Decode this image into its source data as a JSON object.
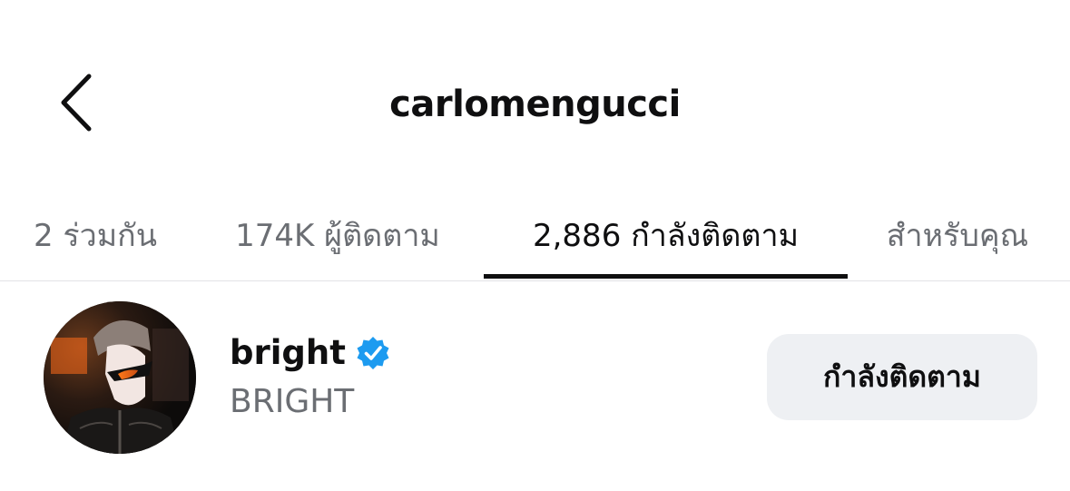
{
  "header": {
    "back_icon": "chevron-left-icon",
    "title": "carlomengucci"
  },
  "tabs": [
    {
      "label": "2 ร่วมกัน",
      "active": false
    },
    {
      "label": "174K ผู้ติดตาม",
      "active": false
    },
    {
      "label": "2,886 กำลังติดตาม",
      "active": true
    },
    {
      "label": "สำหรับคุณ",
      "active": false
    }
  ],
  "list": [
    {
      "username": "bright",
      "verified_icon": "verified-badge-icon",
      "full_name": "BRIGHT",
      "button_label": "กำลังติดตาม",
      "avatar_icon": "profile-photo"
    }
  ],
  "colors": {
    "text_primary": "#0f0f10",
    "text_secondary": "#6b6e73",
    "verified": "#1d9bf0",
    "button_bg": "#eef0f3",
    "divider": "#e2e3e6"
  }
}
